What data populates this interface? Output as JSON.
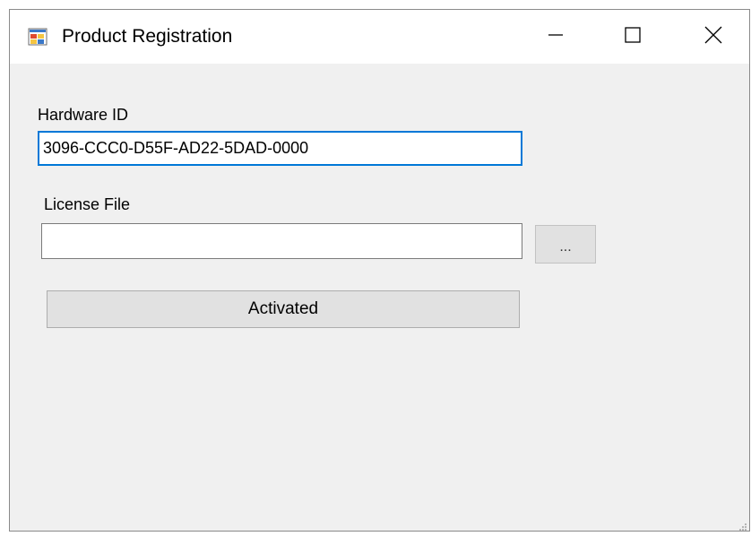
{
  "window": {
    "title": "Product Registration"
  },
  "form": {
    "hardware_id_label": "Hardware ID",
    "hardware_id_value": "3096-CCC0-D55F-AD22-5DAD-0000",
    "license_file_label": "License File",
    "license_file_value": "",
    "browse_label": "...",
    "activate_label": "Activated"
  },
  "icons": {
    "app": "app-form-icon",
    "minimize": "minimize-icon",
    "maximize": "maximize-icon",
    "close": "close-icon",
    "resize": "resize-grip-icon"
  },
  "colors": {
    "focus_border": "#0078d7",
    "window_bg": "#f0f0f0",
    "button_bg": "#e1e1e1"
  }
}
